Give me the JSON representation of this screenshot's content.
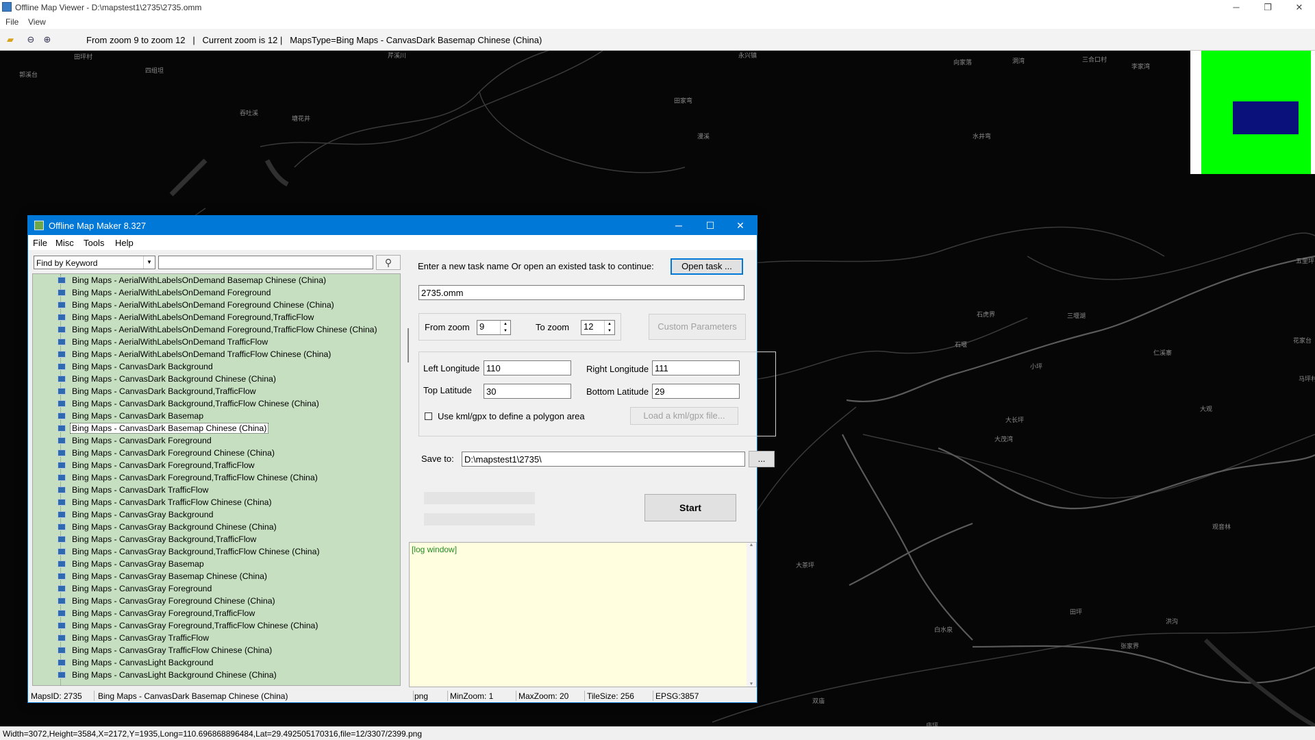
{
  "viewer": {
    "title": "Offline Map Viewer - D:\\mapstest1\\2735\\2735.omm",
    "window_controls": {
      "minimize": "─",
      "maximize": "❐",
      "close": "✕"
    },
    "menu": [
      "File",
      "View"
    ],
    "toolbar_info": "From zoom 9 to zoom 12   |   Current zoom is 12 |   MapsType=Bing Maps - CanvasDark Basemap Chinese (China)",
    "status": "Width=3072,Height=3584,X=2172,Y=1935,Long=110.696868896484,Lat=29.492505170316,file=12/3307/2399.png"
  },
  "map_labels": [
    "田坪村",
    "四组坦",
    "郭溪台",
    "吞吐溪",
    "塘花井",
    "芹溪川",
    "向家落",
    "洞湾",
    "三合口村",
    "李家湾",
    "田家弯",
    "永兴镇",
    "漫溪",
    "水井弯",
    "石虎界",
    "石堰",
    "三堰湖",
    "仁溪寨",
    "大茂湾",
    "大茶坪",
    "田坪",
    "观音林",
    "双庙",
    "庙坪",
    "张家界",
    "白水泉",
    "大长坪",
    "小坪",
    "洪沟",
    "花家台",
    "马坪村",
    "大观",
    "五里坪"
  ],
  "dialog": {
    "title": "Offline Map Maker 8.327",
    "window_controls": {
      "minimize": "─",
      "maximize": "☐",
      "close": "✕"
    },
    "menu": [
      "File",
      "Misc",
      "Tools",
      "Help"
    ],
    "find_mode": "Find by Keyword",
    "search_value": "",
    "map_list": [
      "Bing Maps - AerialWithLabelsOnDemand Basemap Chinese (China)",
      "Bing Maps - AerialWithLabelsOnDemand Foreground",
      "Bing Maps - AerialWithLabelsOnDemand Foreground Chinese (China)",
      "Bing Maps - AerialWithLabelsOnDemand Foreground,TrafficFlow",
      "Bing Maps - AerialWithLabelsOnDemand Foreground,TrafficFlow Chinese (China)",
      "Bing Maps - AerialWithLabelsOnDemand TrafficFlow",
      "Bing Maps - AerialWithLabelsOnDemand TrafficFlow Chinese (China)",
      "Bing Maps - CanvasDark Background",
      "Bing Maps - CanvasDark Background Chinese (China)",
      "Bing Maps - CanvasDark Background,TrafficFlow",
      "Bing Maps - CanvasDark Background,TrafficFlow Chinese (China)",
      "Bing Maps - CanvasDark Basemap",
      "Bing Maps - CanvasDark Basemap Chinese (China)",
      "Bing Maps - CanvasDark Foreground",
      "Bing Maps - CanvasDark Foreground Chinese (China)",
      "Bing Maps - CanvasDark Foreground,TrafficFlow",
      "Bing Maps - CanvasDark Foreground,TrafficFlow Chinese (China)",
      "Bing Maps - CanvasDark TrafficFlow",
      "Bing Maps - CanvasDark TrafficFlow Chinese (China)",
      "Bing Maps - CanvasGray Background",
      "Bing Maps - CanvasGray Background Chinese (China)",
      "Bing Maps - CanvasGray Background,TrafficFlow",
      "Bing Maps - CanvasGray Background,TrafficFlow Chinese (China)",
      "Bing Maps - CanvasGray Basemap",
      "Bing Maps - CanvasGray Basemap Chinese (China)",
      "Bing Maps - CanvasGray Foreground",
      "Bing Maps - CanvasGray Foreground Chinese (China)",
      "Bing Maps - CanvasGray Foreground,TrafficFlow",
      "Bing Maps - CanvasGray Foreground,TrafficFlow Chinese (China)",
      "Bing Maps - CanvasGray TrafficFlow",
      "Bing Maps - CanvasGray TrafficFlow Chinese (China)",
      "Bing Maps - CanvasLight Background",
      "Bing Maps - CanvasLight Background Chinese (China)"
    ],
    "selected_index": 12,
    "task_prompt": "Enter a new task name Or open an existed task to continue:",
    "open_task_label": "Open task ...",
    "task_name": "2735.omm",
    "from_zoom_label": "From zoom",
    "from_zoom": "9",
    "to_zoom_label": "To zoom",
    "to_zoom": "12",
    "custom_params_label": "Custom Parameters",
    "left_lon_label": "Left Longitude",
    "left_lon": "110",
    "right_lon_label": "Right Longitude",
    "right_lon": "111",
    "top_lat_label": "Top Latitude",
    "top_lat": "30",
    "bottom_lat_label": "Bottom Latitude",
    "bottom_lat": "29",
    "kml_checkbox_label": "Use kml/gpx to define a polygon area",
    "kml_checked": false,
    "load_kml_label": "Load a kml/gpx file...",
    "save_to_label": "Save to:",
    "save_to": "D:\\mapstest1\\2735\\",
    "browse_label": "...",
    "start_label": "Start",
    "log_text": "[log window]",
    "status": {
      "maps_id": "MapsID: 2735",
      "map_name": "Bing Maps - CanvasDark Basemap Chinese (China)",
      "format": "png",
      "min_zoom": "MinZoom: 1",
      "max_zoom": "MaxZoom: 20",
      "tile_size": "TileSize: 256",
      "epsg": "EPSG:3857"
    }
  },
  "colors": {
    "accent": "#0078d7",
    "list_bg": "#c5dfc0",
    "log_bg": "#ffffe0",
    "minimap_green": "#00ff00",
    "minimap_blue": "#0a117a"
  }
}
